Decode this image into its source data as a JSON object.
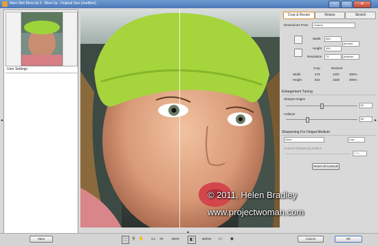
{
  "window": {
    "title": "Alien Skin Blow Up 3 · Blow Up · Original Size (modified)",
    "minimize": "–",
    "maximize": "□",
    "close": "✕"
  },
  "left_panel": {
    "section_label": "User Settings"
  },
  "watermark": {
    "line1": "© 2011, Helen Bradley",
    "line2": "www.projectwoman.com"
  },
  "tabs": [
    {
      "label": "Crop & Resize",
      "active": true
    },
    {
      "label": "Resize",
      "active": false
    },
    {
      "label": "Stretch",
      "active": false
    }
  ],
  "crop": {
    "dimensions_label": "Dimensions From",
    "dimensions_value": "Custom",
    "width_label": "Width",
    "width_value": "300",
    "height_label": "Height",
    "height_value": "300",
    "unit_percent": "percent",
    "resolution_label": "Resolution",
    "resolution_value": "72",
    "resolution_unit": "pixels/in",
    "table_headers": [
      "",
      "Crop",
      "Resized",
      ""
    ],
    "table_rows": [
      [
        "Width",
        "479",
        "1437",
        "300%"
      ],
      [
        "Height",
        "510",
        "1530",
        "300%"
      ]
    ]
  },
  "enlargement": {
    "section": "Enlargement Tuning",
    "sharpen_label": "Sharpen Edges",
    "sharpen_value": "50",
    "sharpen_level": 0.5,
    "artifact_label": "Artifacts",
    "artifact_value": "50",
    "artifact_level": 0.3
  },
  "output": {
    "section": "Sharpening For Output Medium",
    "medium_value": "None",
    "strength_value": "Low",
    "custom_label": "Custom Sharpening Radius",
    "custom_value": "0.00"
  },
  "reset_button": "Reset All Controls",
  "bottom": {
    "save_button": "Save",
    "zoom_label": "1:1",
    "fit_label": "Fit",
    "zoom_value": "100%",
    "before_label": "Before",
    "cancel_button": "Cancel",
    "ok_button": "OK"
  }
}
